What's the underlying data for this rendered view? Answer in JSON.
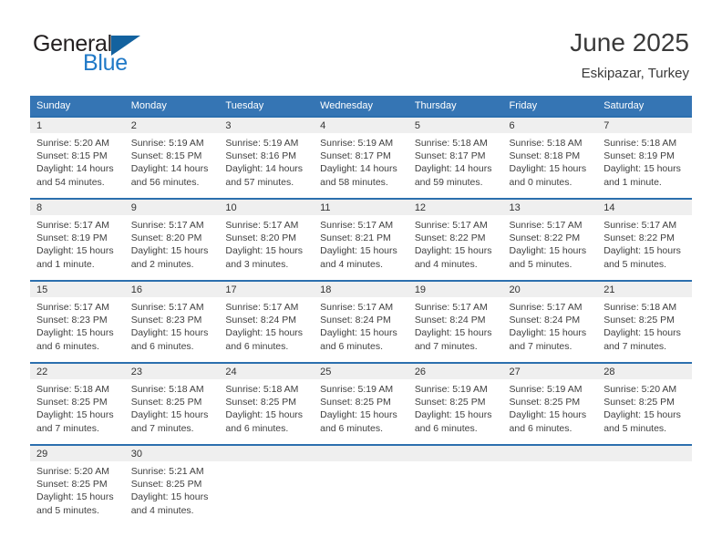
{
  "brand": {
    "name_part1": "General",
    "name_part2": "Blue",
    "triangle_color": "#13629f",
    "blue_color": "#2079c7"
  },
  "header": {
    "title": "June 2025",
    "subtitle": "Eskipazar, Turkey"
  },
  "theme": {
    "header_row_bg": "#3575b4",
    "cell_top_border": "#2c6fae",
    "daynum_band_bg": "#efefef"
  },
  "weekdays": [
    "Sunday",
    "Monday",
    "Tuesday",
    "Wednesday",
    "Thursday",
    "Friday",
    "Saturday"
  ],
  "weeks": [
    [
      {
        "day": "1",
        "sunrise": "Sunrise: 5:20 AM",
        "sunset": "Sunset: 8:15 PM",
        "daylight1": "Daylight: 14 hours",
        "daylight2": "and 54 minutes."
      },
      {
        "day": "2",
        "sunrise": "Sunrise: 5:19 AM",
        "sunset": "Sunset: 8:15 PM",
        "daylight1": "Daylight: 14 hours",
        "daylight2": "and 56 minutes."
      },
      {
        "day": "3",
        "sunrise": "Sunrise: 5:19 AM",
        "sunset": "Sunset: 8:16 PM",
        "daylight1": "Daylight: 14 hours",
        "daylight2": "and 57 minutes."
      },
      {
        "day": "4",
        "sunrise": "Sunrise: 5:19 AM",
        "sunset": "Sunset: 8:17 PM",
        "daylight1": "Daylight: 14 hours",
        "daylight2": "and 58 minutes."
      },
      {
        "day": "5",
        "sunrise": "Sunrise: 5:18 AM",
        "sunset": "Sunset: 8:17 PM",
        "daylight1": "Daylight: 14 hours",
        "daylight2": "and 59 minutes."
      },
      {
        "day": "6",
        "sunrise": "Sunrise: 5:18 AM",
        "sunset": "Sunset: 8:18 PM",
        "daylight1": "Daylight: 15 hours",
        "daylight2": "and 0 minutes."
      },
      {
        "day": "7",
        "sunrise": "Sunrise: 5:18 AM",
        "sunset": "Sunset: 8:19 PM",
        "daylight1": "Daylight: 15 hours",
        "daylight2": "and 1 minute."
      }
    ],
    [
      {
        "day": "8",
        "sunrise": "Sunrise: 5:17 AM",
        "sunset": "Sunset: 8:19 PM",
        "daylight1": "Daylight: 15 hours",
        "daylight2": "and 1 minute."
      },
      {
        "day": "9",
        "sunrise": "Sunrise: 5:17 AM",
        "sunset": "Sunset: 8:20 PM",
        "daylight1": "Daylight: 15 hours",
        "daylight2": "and 2 minutes."
      },
      {
        "day": "10",
        "sunrise": "Sunrise: 5:17 AM",
        "sunset": "Sunset: 8:20 PM",
        "daylight1": "Daylight: 15 hours",
        "daylight2": "and 3 minutes."
      },
      {
        "day": "11",
        "sunrise": "Sunrise: 5:17 AM",
        "sunset": "Sunset: 8:21 PM",
        "daylight1": "Daylight: 15 hours",
        "daylight2": "and 4 minutes."
      },
      {
        "day": "12",
        "sunrise": "Sunrise: 5:17 AM",
        "sunset": "Sunset: 8:22 PM",
        "daylight1": "Daylight: 15 hours",
        "daylight2": "and 4 minutes."
      },
      {
        "day": "13",
        "sunrise": "Sunrise: 5:17 AM",
        "sunset": "Sunset: 8:22 PM",
        "daylight1": "Daylight: 15 hours",
        "daylight2": "and 5 minutes."
      },
      {
        "day": "14",
        "sunrise": "Sunrise: 5:17 AM",
        "sunset": "Sunset: 8:22 PM",
        "daylight1": "Daylight: 15 hours",
        "daylight2": "and 5 minutes."
      }
    ],
    [
      {
        "day": "15",
        "sunrise": "Sunrise: 5:17 AM",
        "sunset": "Sunset: 8:23 PM",
        "daylight1": "Daylight: 15 hours",
        "daylight2": "and 6 minutes."
      },
      {
        "day": "16",
        "sunrise": "Sunrise: 5:17 AM",
        "sunset": "Sunset: 8:23 PM",
        "daylight1": "Daylight: 15 hours",
        "daylight2": "and 6 minutes."
      },
      {
        "day": "17",
        "sunrise": "Sunrise: 5:17 AM",
        "sunset": "Sunset: 8:24 PM",
        "daylight1": "Daylight: 15 hours",
        "daylight2": "and 6 minutes."
      },
      {
        "day": "18",
        "sunrise": "Sunrise: 5:17 AM",
        "sunset": "Sunset: 8:24 PM",
        "daylight1": "Daylight: 15 hours",
        "daylight2": "and 6 minutes."
      },
      {
        "day": "19",
        "sunrise": "Sunrise: 5:17 AM",
        "sunset": "Sunset: 8:24 PM",
        "daylight1": "Daylight: 15 hours",
        "daylight2": "and 7 minutes."
      },
      {
        "day": "20",
        "sunrise": "Sunrise: 5:17 AM",
        "sunset": "Sunset: 8:24 PM",
        "daylight1": "Daylight: 15 hours",
        "daylight2": "and 7 minutes."
      },
      {
        "day": "21",
        "sunrise": "Sunrise: 5:18 AM",
        "sunset": "Sunset: 8:25 PM",
        "daylight1": "Daylight: 15 hours",
        "daylight2": "and 7 minutes."
      }
    ],
    [
      {
        "day": "22",
        "sunrise": "Sunrise: 5:18 AM",
        "sunset": "Sunset: 8:25 PM",
        "daylight1": "Daylight: 15 hours",
        "daylight2": "and 7 minutes."
      },
      {
        "day": "23",
        "sunrise": "Sunrise: 5:18 AM",
        "sunset": "Sunset: 8:25 PM",
        "daylight1": "Daylight: 15 hours",
        "daylight2": "and 7 minutes."
      },
      {
        "day": "24",
        "sunrise": "Sunrise: 5:18 AM",
        "sunset": "Sunset: 8:25 PM",
        "daylight1": "Daylight: 15 hours",
        "daylight2": "and 6 minutes."
      },
      {
        "day": "25",
        "sunrise": "Sunrise: 5:19 AM",
        "sunset": "Sunset: 8:25 PM",
        "daylight1": "Daylight: 15 hours",
        "daylight2": "and 6 minutes."
      },
      {
        "day": "26",
        "sunrise": "Sunrise: 5:19 AM",
        "sunset": "Sunset: 8:25 PM",
        "daylight1": "Daylight: 15 hours",
        "daylight2": "and 6 minutes."
      },
      {
        "day": "27",
        "sunrise": "Sunrise: 5:19 AM",
        "sunset": "Sunset: 8:25 PM",
        "daylight1": "Daylight: 15 hours",
        "daylight2": "and 6 minutes."
      },
      {
        "day": "28",
        "sunrise": "Sunrise: 5:20 AM",
        "sunset": "Sunset: 8:25 PM",
        "daylight1": "Daylight: 15 hours",
        "daylight2": "and 5 minutes."
      }
    ],
    [
      {
        "day": "29",
        "sunrise": "Sunrise: 5:20 AM",
        "sunset": "Sunset: 8:25 PM",
        "daylight1": "Daylight: 15 hours",
        "daylight2": "and 5 minutes."
      },
      {
        "day": "30",
        "sunrise": "Sunrise: 5:21 AM",
        "sunset": "Sunset: 8:25 PM",
        "daylight1": "Daylight: 15 hours",
        "daylight2": "and 4 minutes."
      },
      {
        "day": "",
        "sunrise": "",
        "sunset": "",
        "daylight1": "",
        "daylight2": ""
      },
      {
        "day": "",
        "sunrise": "",
        "sunset": "",
        "daylight1": "",
        "daylight2": ""
      },
      {
        "day": "",
        "sunrise": "",
        "sunset": "",
        "daylight1": "",
        "daylight2": ""
      },
      {
        "day": "",
        "sunrise": "",
        "sunset": "",
        "daylight1": "",
        "daylight2": ""
      },
      {
        "day": "",
        "sunrise": "",
        "sunset": "",
        "daylight1": "",
        "daylight2": ""
      }
    ]
  ]
}
